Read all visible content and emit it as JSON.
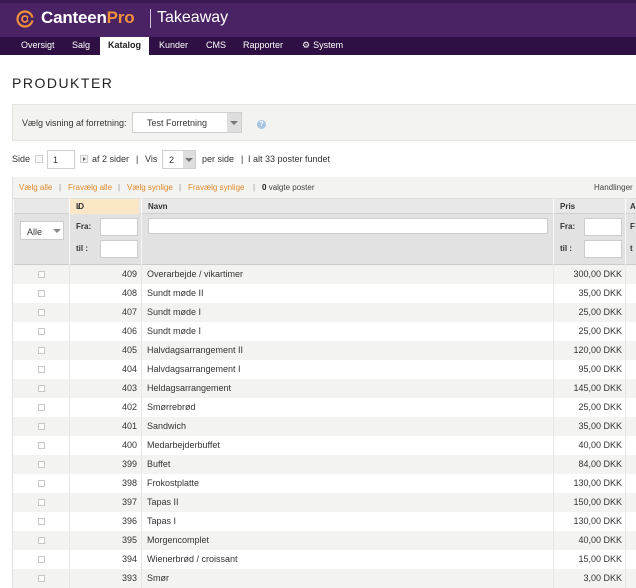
{
  "app": {
    "brand_main": "Canteen",
    "brand_accent": "Pro",
    "module": "Takeaway",
    "colors": {
      "topbar": "#4a2364",
      "nav": "#2e1044",
      "accent": "#f0913a",
      "link": "#e08a2c"
    }
  },
  "nav": {
    "items": [
      {
        "label": "Oversigt"
      },
      {
        "label": "Salg"
      },
      {
        "label": "Katalog",
        "active": true
      },
      {
        "label": "Kunder"
      },
      {
        "label": "CMS"
      },
      {
        "label": "Rapporter"
      },
      {
        "label": "System",
        "icon": "gear-icon"
      }
    ]
  },
  "page": {
    "title": "PRODUKTER"
  },
  "store": {
    "label": "Vælg visning af forretning:",
    "selected": "Test Forretning",
    "help_icon": "help-icon"
  },
  "pager": {
    "page_label": "Side",
    "page_value": "1",
    "of_pages": "af 2 sider",
    "sep1": "|",
    "show_label": "Vis",
    "per_page": "2",
    "per_page_label": "per side",
    "sep2": "|",
    "total": "I alt 33 poster fundet"
  },
  "grid": {
    "actions": {
      "select_all": "Vælg alle",
      "deselect_all": "Fravælg alle",
      "select_visible": "Vælg synlige",
      "deselect_visible": "Fravælg synlige",
      "sep": "|",
      "selected_count": "0",
      "selected_suffix": "valgte poster",
      "handlinger": "Handlinger"
    },
    "headers": {
      "id": "ID",
      "name": "Navn",
      "price": "Pris",
      "extra": "A"
    },
    "filters": {
      "status": "Alle",
      "from_label": "Fra:",
      "to_label": "til :",
      "extra_from": "F",
      "extra_to": "t"
    },
    "rows": [
      {
        "id": "409",
        "name": "Overarbejde / vikartimer",
        "price": "300,00 DKK"
      },
      {
        "id": "408",
        "name": "Sundt møde II",
        "price": "35,00 DKK"
      },
      {
        "id": "407",
        "name": "Sundt møde I",
        "price": "25,00 DKK"
      },
      {
        "id": "406",
        "name": "Sundt møde I",
        "price": "25,00 DKK"
      },
      {
        "id": "405",
        "name": "Halvdagsarrangement II",
        "price": "120,00 DKK"
      },
      {
        "id": "404",
        "name": "Halvdagsarrangement I",
        "price": "95,00 DKK"
      },
      {
        "id": "403",
        "name": "Heldagsarrangement",
        "price": "145,00 DKK"
      },
      {
        "id": "402",
        "name": "Smørrebrød",
        "price": "25,00 DKK"
      },
      {
        "id": "401",
        "name": "Sandwich",
        "price": "35,00 DKK"
      },
      {
        "id": "400",
        "name": "Medarbejderbuffet",
        "price": "40,00 DKK"
      },
      {
        "id": "399",
        "name": "Buffet",
        "price": "84,00 DKK"
      },
      {
        "id": "398",
        "name": "Frokostplatte",
        "price": "130,00 DKK"
      },
      {
        "id": "397",
        "name": "Tapas II",
        "price": "150,00 DKK"
      },
      {
        "id": "396",
        "name": "Tapas I",
        "price": "130,00 DKK"
      },
      {
        "id": "395",
        "name": "Morgencomplet",
        "price": "40,00 DKK"
      },
      {
        "id": "394",
        "name": "Wienerbrød / croissant",
        "price": "15,00 DKK"
      },
      {
        "id": "393",
        "name": "Smør",
        "price": "3,00 DKK"
      }
    ]
  }
}
